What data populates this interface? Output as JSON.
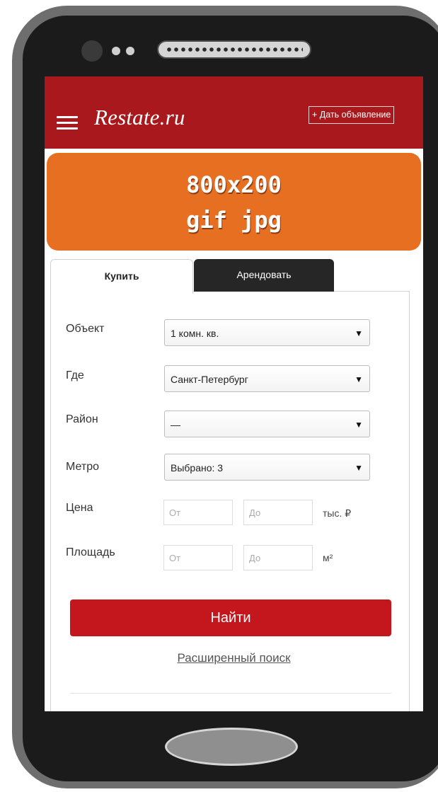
{
  "header": {
    "logo_text": "Restate.ru",
    "post_ad_label": "+ Дать объявление"
  },
  "banner": {
    "line1": "800x200",
    "line2": "gif jpg"
  },
  "tabs": [
    {
      "label": "Купить",
      "active": true
    },
    {
      "label": "Арендовать",
      "active": false
    }
  ],
  "form": {
    "object": {
      "label": "Объект",
      "value": "1 комн. кв."
    },
    "where": {
      "label": "Где",
      "value": "Санкт-Петербург"
    },
    "district": {
      "label": "Район",
      "value": "—"
    },
    "metro": {
      "label": "Метро",
      "value": "Выбрано: 3"
    },
    "price": {
      "label": "Цена",
      "from_placeholder": "От",
      "to_placeholder": "До",
      "unit": "тыс. ₽"
    },
    "area": {
      "label": "Площадь",
      "from_placeholder": "От",
      "to_placeholder": "До",
      "unit": "м²"
    }
  },
  "actions": {
    "find_label": "Найти",
    "advanced_search_label": "Расширенный поиск"
  },
  "icons": {
    "menu": "hamburger-menu-icon",
    "dropdown": "caret-down-icon"
  },
  "colors": {
    "header_bg": "#a9181c",
    "banner_bg": "#e66f22",
    "button_bg": "#c4171d",
    "tab_inactive_bg": "#262626"
  }
}
